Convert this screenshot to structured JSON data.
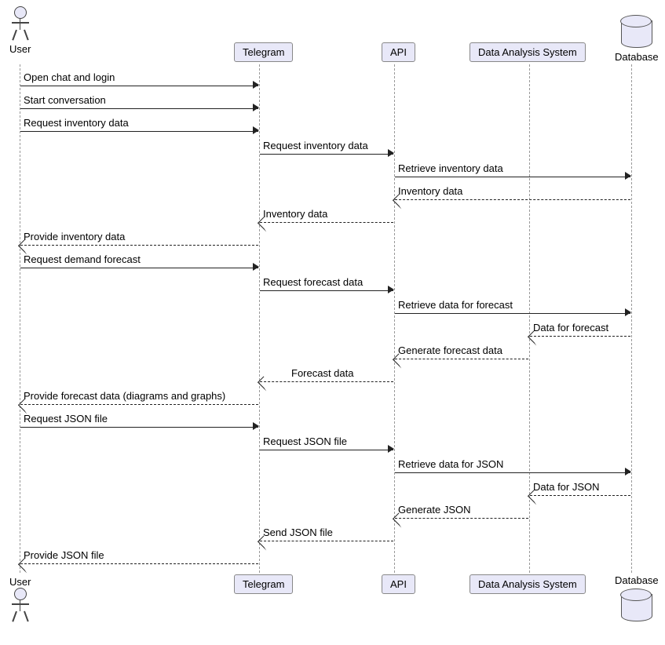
{
  "participants": {
    "user": "User",
    "telegram": "Telegram",
    "api": "API",
    "das": "Data Analysis System",
    "database": "Database"
  },
  "messages": {
    "m1": "Open chat and login",
    "m2": "Start conversation",
    "m3": "Request inventory data",
    "m4": "Request inventory data",
    "m5": "Retrieve inventory data",
    "m6": "Inventory data",
    "m7": "Inventory data",
    "m8": "Provide inventory data",
    "m9": "Request demand forecast",
    "m10": "Request forecast data",
    "m11": "Retrieve data for forecast",
    "m12": "Data for forecast",
    "m13": "Generate forecast data",
    "m14": "Forecast data",
    "m15": "Provide forecast data (diagrams and graphs)",
    "m16": "Request JSON file",
    "m17": "Request JSON file",
    "m18": "Retrieve data for JSON",
    "m19": "Data for JSON",
    "m20": "Generate JSON",
    "m21": "Send JSON file",
    "m22": "Provide JSON file"
  },
  "chart_data": {
    "type": "sequence-diagram",
    "participants": [
      "User",
      "Telegram",
      "API",
      "Data Analysis System",
      "Database"
    ],
    "messages": [
      {
        "from": "User",
        "to": "Telegram",
        "label": "Open chat and login",
        "style": "solid"
      },
      {
        "from": "User",
        "to": "Telegram",
        "label": "Start conversation",
        "style": "solid"
      },
      {
        "from": "User",
        "to": "Telegram",
        "label": "Request inventory data",
        "style": "solid"
      },
      {
        "from": "Telegram",
        "to": "API",
        "label": "Request inventory data",
        "style": "solid"
      },
      {
        "from": "API",
        "to": "Database",
        "label": "Retrieve inventory data",
        "style": "solid"
      },
      {
        "from": "Database",
        "to": "API",
        "label": "Inventory data",
        "style": "dashed"
      },
      {
        "from": "API",
        "to": "Telegram",
        "label": "Inventory data",
        "style": "dashed"
      },
      {
        "from": "Telegram",
        "to": "User",
        "label": "Provide inventory data",
        "style": "dashed"
      },
      {
        "from": "User",
        "to": "Telegram",
        "label": "Request demand forecast",
        "style": "solid"
      },
      {
        "from": "Telegram",
        "to": "API",
        "label": "Request forecast data",
        "style": "solid"
      },
      {
        "from": "API",
        "to": "Database",
        "label": "Retrieve data for forecast",
        "style": "solid"
      },
      {
        "from": "Database",
        "to": "Data Analysis System",
        "label": "Data for forecast",
        "style": "dashed"
      },
      {
        "from": "Data Analysis System",
        "to": "API",
        "label": "Generate forecast data",
        "style": "dashed"
      },
      {
        "from": "API",
        "to": "Telegram",
        "label": "Forecast data",
        "style": "dashed"
      },
      {
        "from": "Telegram",
        "to": "User",
        "label": "Provide forecast data (diagrams and graphs)",
        "style": "dashed"
      },
      {
        "from": "User",
        "to": "Telegram",
        "label": "Request JSON file",
        "style": "solid"
      },
      {
        "from": "Telegram",
        "to": "API",
        "label": "Request JSON file",
        "style": "solid"
      },
      {
        "from": "API",
        "to": "Database",
        "label": "Retrieve data for JSON",
        "style": "solid"
      },
      {
        "from": "Database",
        "to": "Data Analysis System",
        "label": "Data for JSON",
        "style": "dashed"
      },
      {
        "from": "Data Analysis System",
        "to": "API",
        "label": "Generate JSON",
        "style": "dashed"
      },
      {
        "from": "API",
        "to": "Telegram",
        "label": "Send JSON file",
        "style": "dashed"
      },
      {
        "from": "Telegram",
        "to": "User",
        "label": "Provide JSON file",
        "style": "dashed"
      }
    ]
  }
}
